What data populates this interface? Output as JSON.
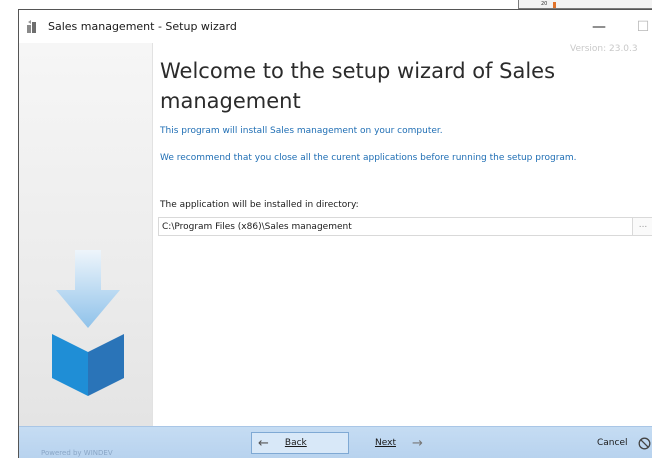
{
  "background_window": {
    "marker_text": "20"
  },
  "window": {
    "title": "Sales management - Setup wizard",
    "minimize_glyph": "—",
    "maximize_glyph": "☐",
    "close_glyph": "✕"
  },
  "version_text": "Version: 23.0.3",
  "heading": "Welcome to the setup wizard of Sales management",
  "info_lines": [
    "This program will install Sales management on your computer.",
    "We recommend that you close all the curent applications before running the setup program."
  ],
  "install_dir": {
    "label": "The application will be installed in directory:",
    "value": "C:\\Program Files (x86)\\Sales management",
    "browse_label": "..."
  },
  "footer": {
    "powered_by": "Powered by WINDEV",
    "back_label": "Back",
    "next_label": "Next",
    "cancel_label": "Cancel",
    "back_arrow": "←",
    "next_arrow": "→",
    "cancel_glyph": "⃠"
  },
  "colors": {
    "accent_blue": "#1f6eb4",
    "footer_blue": "#c5dcf3",
    "logo_blue": "#1f8ed6"
  },
  "icons": [
    "app-icon",
    "install-arrow-logo",
    "back-arrow-icon",
    "next-arrow-icon",
    "cancel-icon"
  ]
}
